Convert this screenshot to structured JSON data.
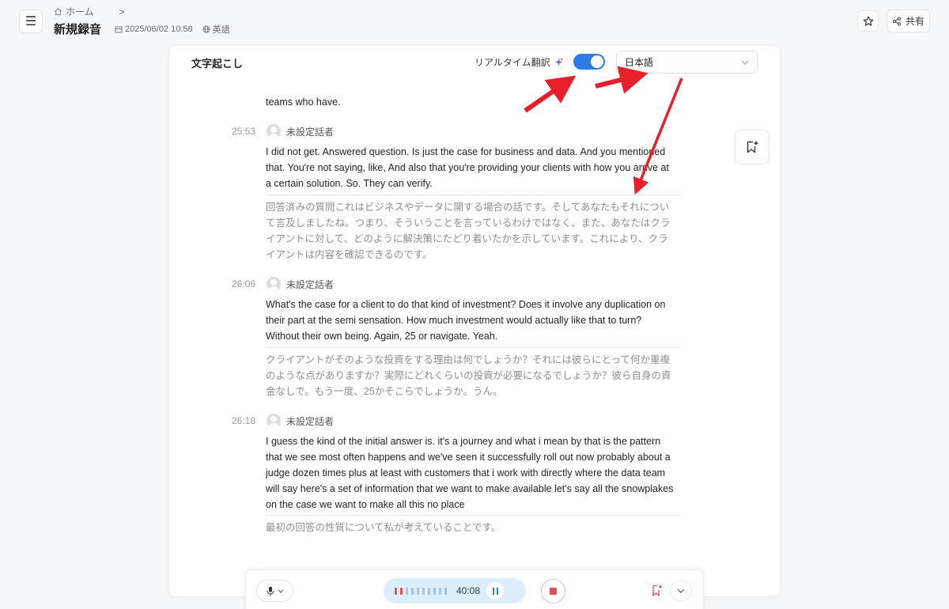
{
  "header": {
    "breadcrumb_home": "ホーム",
    "breadcrumb_sep": ">",
    "title": "新規録音",
    "date": "2025/06/02 10:58",
    "language": "英語",
    "share_label": "共有"
  },
  "transcript": {
    "title": "文字起こし",
    "realtime_label": "リアルタイム翻訳",
    "realtime_enabled": true,
    "target_language": "日本語",
    "partial_top": "teams who have.",
    "segments": [
      {
        "time": "25:53",
        "speaker": "未設定話者",
        "lines": [
          "I did not get. Answered question. Is just the case for business and data. And you mentioned",
          "that. You're not saying, like, And also that you're providing your clients with how you arrive at",
          "a certain solution. So. They can verify."
        ],
        "translation_lines": [
          "回答済みの質問これはビジネスやデータに関する場合の話です。そしてあなたもそれについ",
          "て言及しましたね。つまり、そういうことを言っているわけではなく、また、あなたはクラ",
          "イアントに対して、どのように解決策にたどり着いたかを示しています。これにより、クラ",
          "イアントは内容を確認できるのです。"
        ]
      },
      {
        "time": "26:06",
        "speaker": "未設定話者",
        "lines": [
          "What's the case for a client to do that kind of investment? Does it involve any duplication on",
          "their part at the semi sensation. How much investment would actually like that to turn?",
          "Without their own being. Again, 25 or navigate. Yeah."
        ],
        "translation_lines": [
          "クライアントがそのような投資をする理由は何でしょうか？それには彼らにとって何か重複",
          "のような点がありますか？実際にどれくらいの投資が必要になるでしょうか？彼ら自身の資",
          "金なしで。もう一度、25かそこらでしょうか。うん。"
        ]
      },
      {
        "time": "26:18",
        "speaker": "未設定話者",
        "lines": [
          "I guess the kind of the initial answer is. it's a journey and what i mean by that is the pattern",
          "that we see most often happens and we've seen it successfully roll out now probably about a",
          "judge dozen times plus at least with customers that i work with directly where the data team",
          "will say here's a set of information that we want to make available let's say all the snowplakes",
          "on the case we want to make all this no place"
        ],
        "translation_lines": [
          "最初の回答の性質について私が考えていることです。"
        ]
      }
    ]
  },
  "recorder": {
    "elapsed": "40:08"
  },
  "colors": {
    "accent": "#2f7be5",
    "record_red": "#e0505a",
    "annotation_red": "#e8202a"
  }
}
